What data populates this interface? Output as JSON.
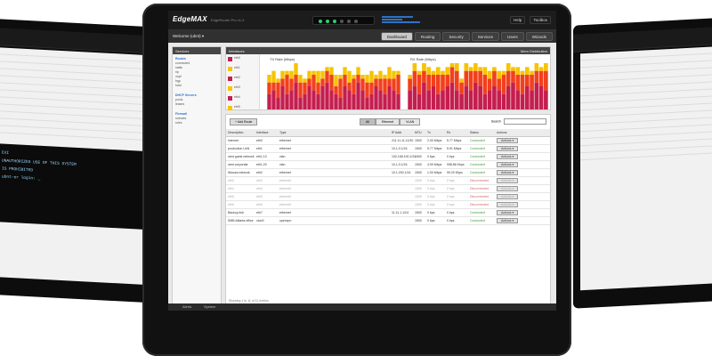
{
  "window": {
    "logo": "EdgeMAX",
    "firmware": "EdgeRouter Pro v1.4",
    "user": "ubnt"
  },
  "nav": {
    "welcome": "Welcome (ubnt) ▾",
    "tabs": [
      {
        "label": "Dashboard",
        "active": true
      },
      {
        "label": "Routing",
        "active": false
      },
      {
        "label": "Security",
        "active": false
      },
      {
        "label": "Services",
        "active": false
      },
      {
        "label": "Users",
        "active": false
      },
      {
        "label": "Wizards",
        "active": false
      }
    ],
    "top_actions": [
      "Help",
      "Toolbox"
    ]
  },
  "services_panel": {
    "title": "Services",
    "sections": [
      {
        "title": "Routes",
        "lines": [
          "connected",
          "static",
          "rip",
          "ospf",
          "bgp",
          "total"
        ]
      },
      {
        "title": "DHCP Servers",
        "lines": [
          "pools",
          "leases"
        ]
      },
      {
        "title": "Firewall",
        "lines": [
          "rulesets",
          "rules"
        ]
      }
    ]
  },
  "interfaces_panel": {
    "title": "Interfaces",
    "items": [
      "eth0",
      "eth1",
      "eth2",
      "eth3",
      "eth4",
      "eth5",
      "eth6",
      "eth7"
    ],
    "right_title": "Mem Distribution"
  },
  "charts": {
    "left_title": "TX Rate (Mbps)",
    "right_title": "RX Rate (Mbps)"
  },
  "chart_data": [
    {
      "type": "bar",
      "stacked": true,
      "series": [
        {
          "values": [
            4,
            5,
            3,
            6,
            4,
            5,
            7,
            3,
            4,
            6,
            5,
            4,
            6,
            7,
            5,
            4,
            3,
            6,
            5,
            4,
            7,
            5,
            3,
            4,
            6,
            5,
            4,
            6,
            5,
            4
          ]
        },
        {
          "values": [
            3,
            2,
            4,
            2,
            5,
            3,
            2,
            4,
            3,
            2,
            4,
            3,
            2,
            3,
            4,
            2,
            5,
            3,
            2,
            4,
            2,
            3,
            4,
            3,
            2,
            3,
            4,
            2,
            3,
            5
          ]
        },
        {
          "values": [
            2,
            3,
            1,
            2,
            1,
            2,
            3,
            2,
            1,
            2,
            1,
            3,
            2,
            1,
            2,
            3,
            1,
            2,
            3,
            1,
            2,
            1,
            2,
            3,
            1,
            2,
            1,
            3,
            2,
            1
          ]
        }
      ],
      "colors": [
        "#c41e4f",
        "#f2401c",
        "#f6c400"
      ]
    },
    {
      "type": "bar",
      "stacked": true,
      "series": [
        {
          "values": [
            5,
            6,
            4,
            7,
            5,
            6,
            4,
            5,
            6,
            7,
            5,
            4,
            6,
            5,
            7,
            6,
            4,
            5,
            6,
            5,
            4,
            6,
            7,
            5,
            4,
            6,
            5,
            7,
            6,
            5
          ]
        },
        {
          "values": [
            3,
            4,
            5,
            3,
            4,
            3,
            5,
            4,
            3,
            4,
            5,
            3,
            4,
            5,
            3,
            4,
            5,
            3,
            4,
            3,
            5,
            4,
            3,
            4,
            5,
            3,
            4,
            3,
            4,
            5
          ]
        },
        {
          "values": [
            1,
            2,
            1,
            2,
            2,
            1,
            2,
            1,
            2,
            1,
            2,
            1,
            2,
            1,
            2,
            1,
            2,
            2,
            1,
            2,
            1,
            2,
            1,
            2,
            1,
            2,
            1,
            2,
            1,
            2
          ]
        }
      ],
      "colors": [
        "#c41e4f",
        "#f2401c",
        "#f6c400"
      ]
    }
  ],
  "table": {
    "add_label": "+ Add Route",
    "filters": [
      {
        "label": "All",
        "active": true
      },
      {
        "label": "Ethernet",
        "active": false
      },
      {
        "label": "VLAN",
        "active": false
      }
    ],
    "search_label": "Search",
    "columns": [
      "Description",
      "Interface",
      "Type",
      "IP Addr",
      "MTU",
      "Tx",
      "Rx",
      "Status",
      "Actions"
    ],
    "rows": [
      {
        "desc": "Internet",
        "iface": "eth0",
        "type": "ethernet",
        "ip": "211.11.11.11/30",
        "mtu": "1500",
        "tx": "2.00 Mbps",
        "rx": "5.77 Mbps",
        "status": "Connected",
        "dim": false
      },
      {
        "desc": "production LAN",
        "iface": "eth1",
        "type": "ethernet",
        "ip": "10.1.0.1/24",
        "mtu": "1500",
        "tx": "5.77 Mbps",
        "rx": "5.91 Mbps",
        "status": "Connected",
        "dim": false
      },
      {
        "desc": "ubnt guest network",
        "iface": "eth1.10",
        "type": "vlan",
        "ip": "192.168.100.1/24",
        "mtu": "1500",
        "tx": "0 bps",
        "rx": "0 bps",
        "status": "Connected",
        "dim": false
      },
      {
        "desc": "ubnt corporate",
        "iface": "eth1.20",
        "type": "vlan",
        "ip": "10.1.0.1/24",
        "mtu": "1500",
        "tx": "4.99 Mbps",
        "rx": "998.86 Kbps",
        "status": "Connected",
        "dim": false
      },
      {
        "desc": "Wowza network",
        "iface": "eth2",
        "type": "ethernet",
        "ip": "10.1.200.1/24",
        "mtu": "1500",
        "tx": "1.00 Mbps",
        "rx": "99.29 Kbps",
        "status": "Connected",
        "dim": false
      },
      {
        "desc": "eth3",
        "iface": "eth3",
        "type": "ethernet",
        "ip": "",
        "mtu": "1500",
        "tx": "0 bps",
        "rx": "0 bps",
        "status": "Disconnected",
        "dim": true
      },
      {
        "desc": "eth4",
        "iface": "eth4",
        "type": "ethernet",
        "ip": "",
        "mtu": "1500",
        "tx": "0 bps",
        "rx": "0 bps",
        "status": "Disconnected",
        "dim": true
      },
      {
        "desc": "eth5",
        "iface": "eth5",
        "type": "ethernet",
        "ip": "",
        "mtu": "1500",
        "tx": "0 bps",
        "rx": "0 bps",
        "status": "Disconnected",
        "dim": true
      },
      {
        "desc": "eth6",
        "iface": "eth6",
        "type": "ethernet",
        "ip": "",
        "mtu": "1500",
        "tx": "0 bps",
        "rx": "0 bps",
        "status": "Disconnected",
        "dim": true
      },
      {
        "desc": "Backup link",
        "iface": "eth7",
        "type": "ethernet",
        "ip": "11.11.1.1/24",
        "mtu": "1500",
        "tx": "0 bps",
        "rx": "0 bps",
        "status": "Connected",
        "dim": false
      },
      {
        "desc": "SMB Atlanta office",
        "iface": "vtun0",
        "type": "openvpn",
        "ip": "",
        "mtu": "1500",
        "tx": "0 bps",
        "rx": "0 bps",
        "status": "Connected",
        "dim": false
      }
    ],
    "action_label": "Actions ▾",
    "footer": "Showing 1 to 11 of 11 entries"
  },
  "bottom_strip": {
    "items": [
      "Alerts",
      "System"
    ]
  },
  "terminal": {
    "lines": [
      "EXI",
      "UNAUTHORIZED USE OF THIS SYSTEM",
      "IS PROHIBITED",
      "ubnt-er login: _"
    ]
  }
}
